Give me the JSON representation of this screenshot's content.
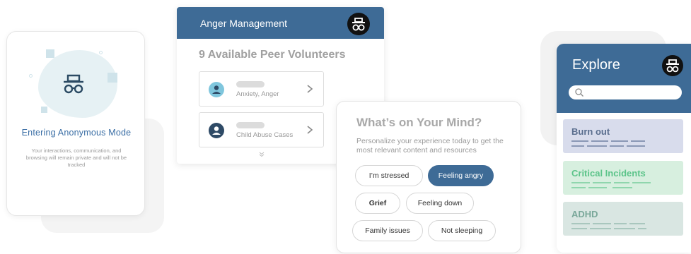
{
  "anonymous_mode": {
    "title": "Entering Anonymous Mode",
    "description": "Your interactions, communication, and browsing will remain private and will not be tracked",
    "icon": "incognito-icon"
  },
  "peer_panel": {
    "header_title": "Anger Management",
    "header_icon": "incognito-icon",
    "volunteer_count": "9 Available Peer Volunteers",
    "volunteers": [
      {
        "tags": "Anxiety, Anger",
        "avatar_color": "#7fc6dd"
      },
      {
        "tags": "Child Abuse Cases",
        "avatar_color": "#2e4a66"
      }
    ]
  },
  "mind_panel": {
    "title": "What’s on Your Mind?",
    "subtitle": "Personalize your experience today to get the most relevant content and resources",
    "chips": [
      {
        "label": "I’m stressed",
        "selected": false
      },
      {
        "label": "Feeling angry",
        "selected": true
      },
      {
        "label": "Grief",
        "selected": false
      },
      {
        "label": "Feeling down",
        "selected": false
      },
      {
        "label": "Family issues",
        "selected": false
      },
      {
        "label": "Not sleeping",
        "selected": false
      }
    ]
  },
  "explore_panel": {
    "title": "Explore",
    "header_icon": "incognito-icon",
    "search_placeholder": "",
    "topics": [
      {
        "label": "Burn out",
        "color": "#5a6e8e"
      },
      {
        "label": "Critical Incidents",
        "color": "#5cc48a"
      },
      {
        "label": "ADHD",
        "color": "#7aa89a"
      }
    ]
  },
  "colors": {
    "primary": "#3e6b96",
    "anon_accent": "#3a6ea5"
  }
}
